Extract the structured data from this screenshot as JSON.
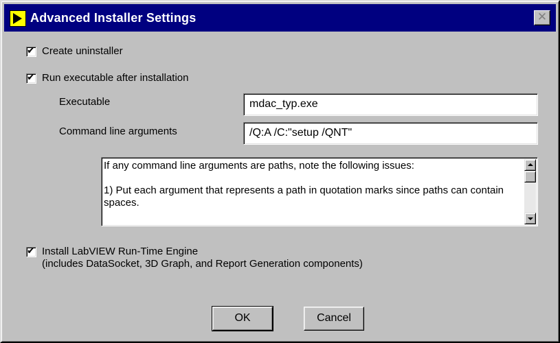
{
  "window": {
    "title": "Advanced Installer Settings",
    "close_glyph": "✕"
  },
  "options": {
    "create_uninstaller": {
      "label": "Create uninstaller",
      "checked": true
    },
    "run_executable": {
      "label": "Run executable after installation",
      "checked": true
    },
    "install_runtime": {
      "label_line1": "Install LabVIEW Run-Time Engine",
      "label_line2": "(includes DataSocket, 3D Graph, and Report Generation components)",
      "checked": true
    }
  },
  "fields": {
    "executable": {
      "label": "Executable",
      "value": "mdac_typ.exe"
    },
    "command_line": {
      "label": "Command line arguments",
      "value": "/Q:A /C:\"setup /QNT\""
    }
  },
  "info": {
    "line1": "If any command line arguments are paths, note the following issues:",
    "line2": "1) Put each argument that represents a path in quotation marks since paths can contain spaces."
  },
  "buttons": {
    "ok": "OK",
    "cancel": "Cancel"
  },
  "check_glyph": "✔",
  "colors": {
    "titlebar": "#000080",
    "face": "#c0c0c0"
  }
}
